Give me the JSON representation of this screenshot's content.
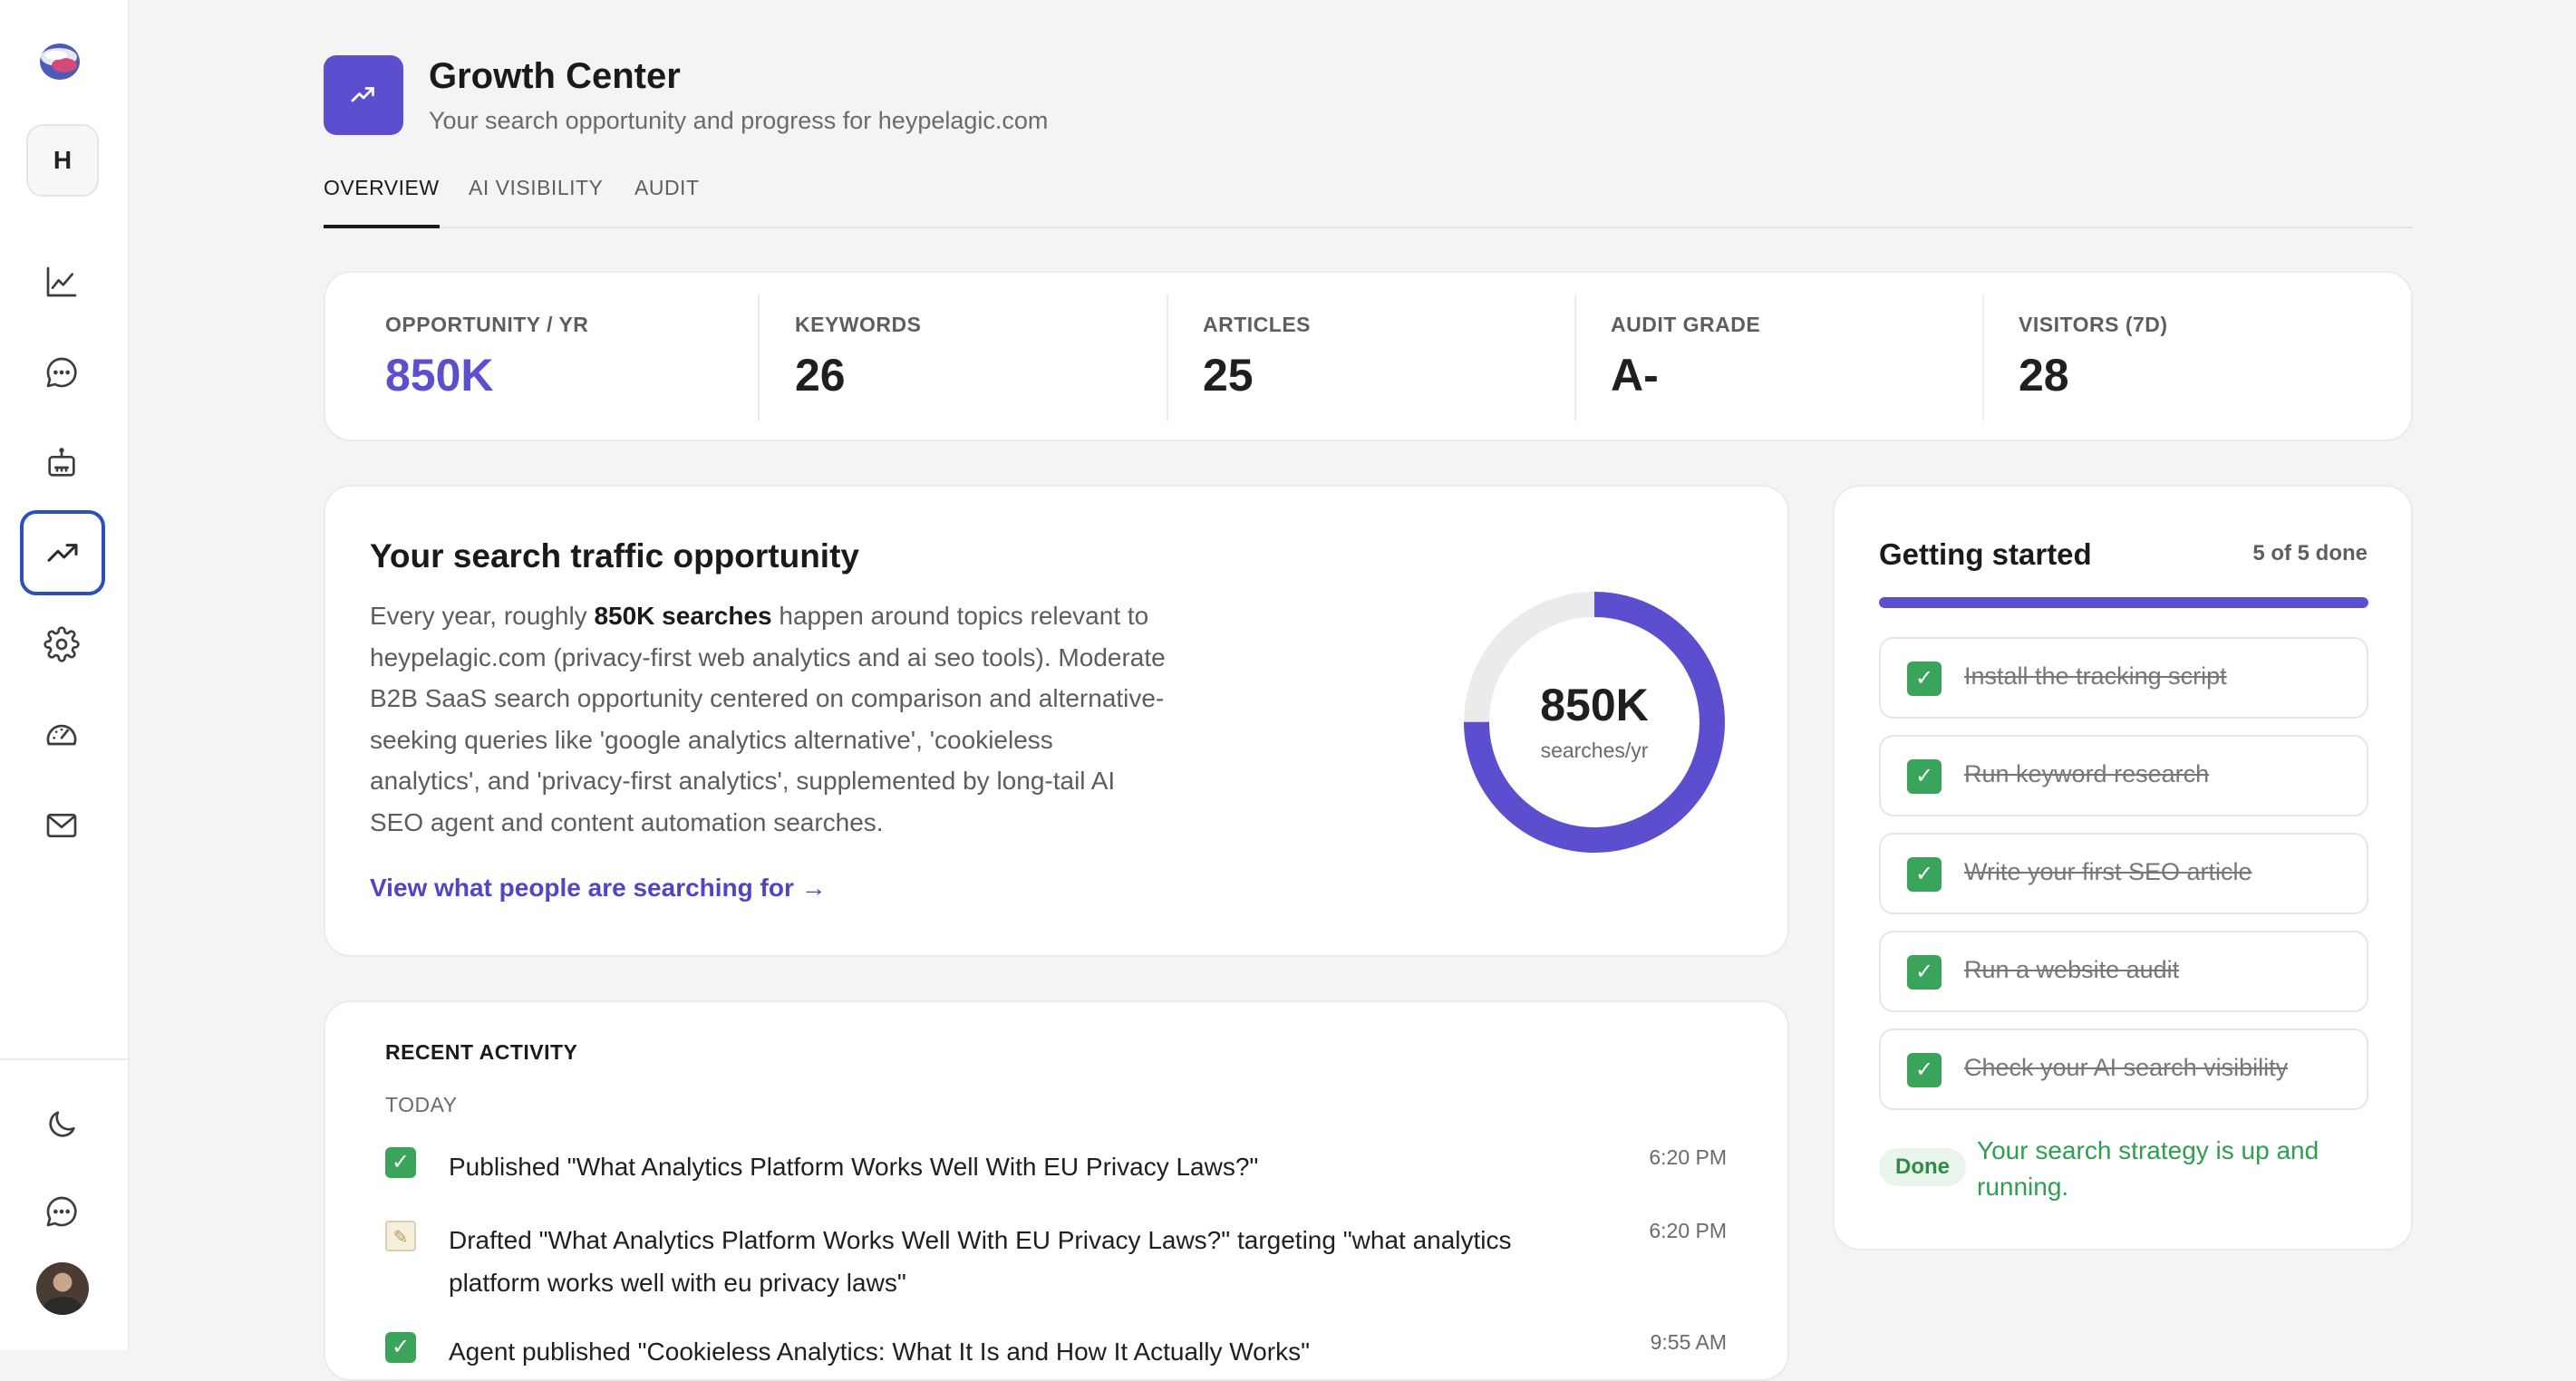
{
  "sidebar": {
    "workspace_initial": "H",
    "nav_items": [
      {
        "icon": "chart-line-icon",
        "active": false
      },
      {
        "icon": "chat-bubble-icon",
        "active": false
      },
      {
        "icon": "robot-icon",
        "active": false
      },
      {
        "icon": "trending-up-icon",
        "active": true
      },
      {
        "icon": "gear-icon",
        "active": false
      },
      {
        "icon": "speedometer-icon",
        "active": false
      },
      {
        "icon": "mail-icon",
        "active": false
      }
    ],
    "bottom_items": [
      {
        "icon": "moon-icon"
      },
      {
        "icon": "chat-bubble-icon"
      },
      {
        "icon": "user-avatar"
      }
    ]
  },
  "header": {
    "title": "Growth Center",
    "subtitle": "Your search opportunity and progress for heypelagic.com",
    "icon": "trending-up-icon",
    "accent_color": "#5b4fcf"
  },
  "tabs": [
    {
      "label": "OVERVIEW",
      "active": true
    },
    {
      "label": "AI VISIBILITY",
      "active": false
    },
    {
      "label": "AUDIT",
      "active": false
    }
  ],
  "stats": [
    {
      "label": "OPPORTUNITY / YR",
      "value": "850K"
    },
    {
      "label": "KEYWORDS",
      "value": "26"
    },
    {
      "label": "ARTICLES",
      "value": "25"
    },
    {
      "label": "AUDIT GRADE",
      "value": "A-"
    },
    {
      "label": "VISITORS (7D)",
      "value": "28"
    }
  ],
  "opportunity": {
    "title": "Your search traffic opportunity",
    "body_prefix": "Every year, roughly ",
    "body_bold": "850K searches",
    "body_suffix": " happen around topics relevant to heypelagic.com (privacy-first web analytics and ai seo tools). Moderate B2B SaaS search opportunity centered on comparison and alternative-seeking queries like 'google analytics alternative', 'cookieless analytics', and 'privacy-first analytics', supplemented by long-tail AI SEO agent and content automation searches.",
    "link": "View what people are searching for →",
    "donut_value": "850K",
    "donut_unit": "searches/yr",
    "donut_fill_fraction": 0.75
  },
  "activity": {
    "heading": "RECENT ACTIVITY",
    "day": "TODAY",
    "items": [
      {
        "icon": "check-icon",
        "text": "Published \"What Analytics Platform Works Well With EU Privacy Laws?\"",
        "time": "6:20 PM"
      },
      {
        "icon": "memo-icon",
        "text": "Drafted \"What Analytics Platform Works Well With EU Privacy Laws?\" targeting \"what analytics platform works well with eu privacy laws\"",
        "time": "6:20 PM"
      },
      {
        "icon": "check-icon",
        "text": "Agent published \"Cookieless Analytics: What It Is and How It Actually Works\"",
        "time": "9:55 AM"
      }
    ]
  },
  "getting_started": {
    "title": "Getting started",
    "progress_text": "5 of 5 done",
    "progress_fraction": 1.0,
    "items": [
      {
        "label": "Install the tracking script",
        "done": true
      },
      {
        "label": "Run keyword research",
        "done": true
      },
      {
        "label": "Write your first SEO article",
        "done": true
      },
      {
        "label": "Run a website audit",
        "done": true
      },
      {
        "label": "Check your AI search visibility",
        "done": true
      }
    ],
    "done_badge": "Done",
    "done_text": "Your search strategy is up and running."
  }
}
